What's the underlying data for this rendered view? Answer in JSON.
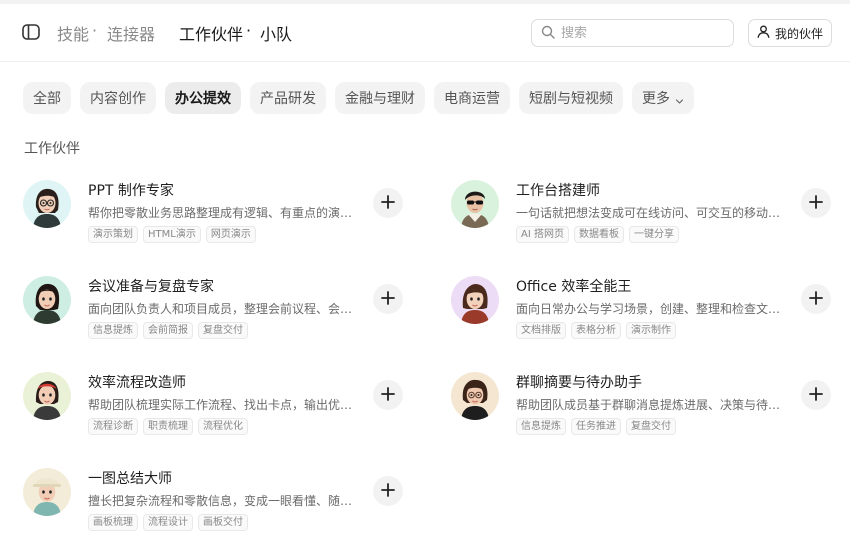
{
  "header": {
    "nav_skills": "技能",
    "nav_sep1": "·",
    "nav_connectors": "连接器",
    "nav_partners": "工作伙伴",
    "nav_sep2": "·",
    "nav_teams": "小队",
    "search_placeholder": "搜索",
    "my_partners_label": "我的伙伴"
  },
  "tabs": [
    {
      "label": "全部"
    },
    {
      "label": "内容创作"
    },
    {
      "label": "办公提效",
      "active": true
    },
    {
      "label": "产品研发"
    },
    {
      "label": "金融与理财"
    },
    {
      "label": "电商运营"
    },
    {
      "label": "短剧与短视频"
    },
    {
      "label": "更多"
    }
  ],
  "section_title": "工作伙伴",
  "cards": [
    {
      "title": "PPT 制作专家",
      "desc": "帮你把零散业务思路整理成有逻辑、有重点的演示文稿",
      "tags": [
        "演示策划",
        "HTML演示",
        "网页演示"
      ],
      "avatar_bg": "#dff4f4"
    },
    {
      "title": "工作台搭建师",
      "desc": "一句话就把想法变成可在线访问、可交互的移动端工作台",
      "tags": [
        "AI 搭网页",
        "数据看板",
        "一键分享"
      ],
      "avatar_bg": "#d9f2dd"
    },
    {
      "title": "会议准备与复盘专家",
      "desc": "面向团队负责人和项目成员，整理会前议程、会后纪要",
      "tags": [
        "信息提炼",
        "会前简报",
        "复盘交付"
      ],
      "avatar_bg": "#cfeee3"
    },
    {
      "title": "Office 效率全能王",
      "desc": "面向日常办公与学习场景，创建、整理和检查文档表格",
      "tags": [
        "文档排版",
        "表格分析",
        "演示制作"
      ],
      "avatar_bg": "#eddcf5"
    },
    {
      "title": "效率流程改造师",
      "desc": "帮助团队梳理实际工作流程、找出卡点，输出优化方案",
      "tags": [
        "流程诊断",
        "职责梳理",
        "流程优化"
      ],
      "avatar_bg": "#e9f2d6"
    },
    {
      "title": "群聊摘要与待办助手",
      "desc": "帮助团队成员基于群聊消息提炼进展、决策与待办事项",
      "tags": [
        "信息提炼",
        "任务推进",
        "复盘交付"
      ],
      "avatar_bg": "#f5e6d2"
    },
    {
      "title": "一图总结大师",
      "desc": "擅长把复杂流程和零散信息，变成一眼看懂、随手可用的图",
      "tags": [
        "画板梳理",
        "流程设计",
        "画板交付"
      ],
      "avatar_bg": "#f3ecd9"
    }
  ],
  "colors": {
    "accent": "#1f1f1f",
    "muted": "#8a8a8a",
    "chip_bg": "#f3f3f3"
  },
  "icons": [
    "sidebar-toggle-icon",
    "search-icon",
    "user-icon",
    "chevron-down-icon",
    "plus-icon"
  ]
}
